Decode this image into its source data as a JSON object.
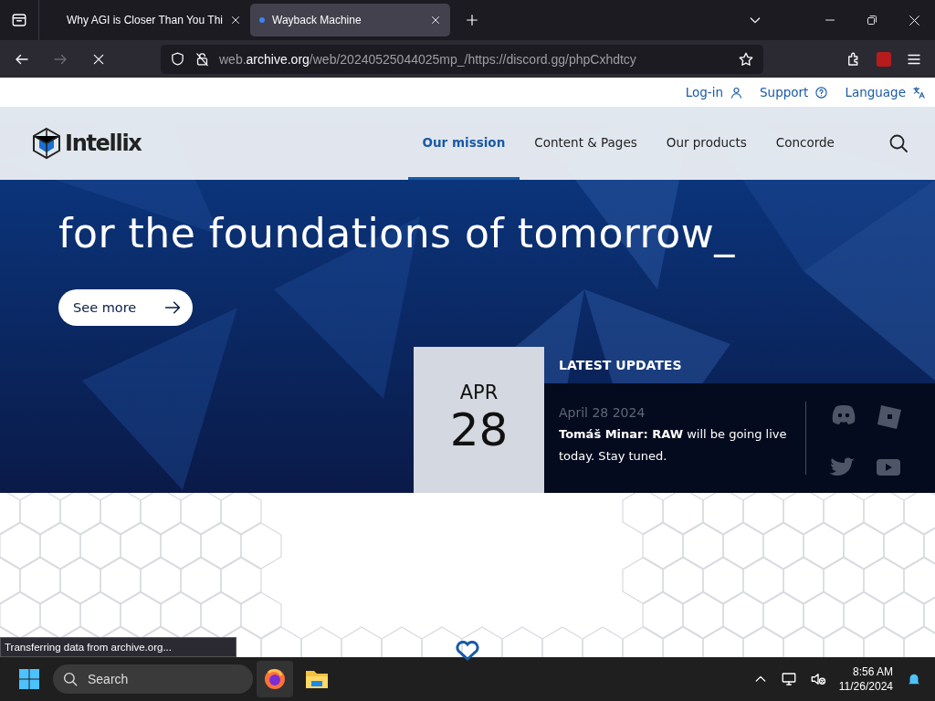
{
  "browser": {
    "tabs": [
      {
        "title": "Why AGI is Closer Than You Thi",
        "selected": false
      },
      {
        "title": "Wayback Machine",
        "selected": true
      }
    ],
    "url": "web.**archive.org**/web/20240525044025mp_/https://discord.gg/phpCxhdtcy"
  },
  "site": {
    "utility_links": [
      {
        "label": "Log-in",
        "kind": "user"
      },
      {
        "label": "Support",
        "kind": "help"
      },
      {
        "label": "Language",
        "kind": "language"
      }
    ],
    "logo": "Intellix",
    "nav": [
      {
        "label": "Our mission",
        "selected": true
      },
      {
        "label": "Content & Pages",
        "selected": false
      },
      {
        "label": "Our products",
        "selected": false
      },
      {
        "label": "Concorde",
        "selected": false
      }
    ],
    "hero": {
      "headline": [
        "for the foundations of tomorrow_"
      ],
      "button": "See more"
    },
    "updates": {
      "month": "APR",
      "day": "28",
      "heading": "LATEST UPDATES",
      "date": "April 28 2024",
      "text": "**Tomáš Minar: RAW** will be going live today. Stay tuned."
    }
  },
  "status": "Transferring data from archive.org...",
  "taskbar": {
    "search_placeholder": "Search",
    "time": "8:56 AM",
    "date": "11/26/2024"
  }
}
